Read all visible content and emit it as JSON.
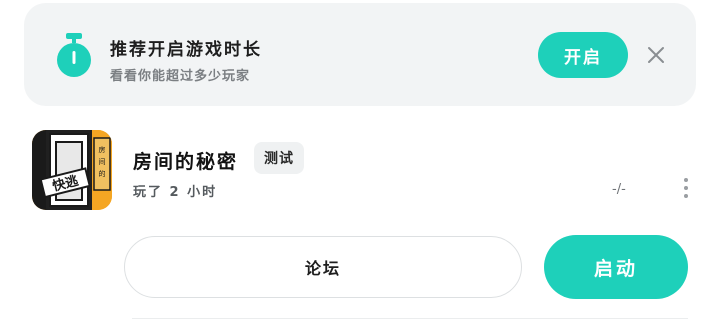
{
  "banner": {
    "title": "推荐开启游戏时长",
    "subtitle": "看看你能超过多少玩家",
    "enable_label": "开启",
    "icon": "timer-icon",
    "close_icon": "close-icon"
  },
  "game": {
    "name": "房间的秘密",
    "tag": "测试",
    "play_time": "玩了 2 小时",
    "rating": "-/-",
    "thumb_text": "快逃",
    "more_icon": "more-vertical-icon"
  },
  "actions": {
    "forum_label": "论坛",
    "launch_label": "启动"
  },
  "colors": {
    "accent": "#1ed0ba",
    "banner_bg": "#f2f4f5"
  }
}
